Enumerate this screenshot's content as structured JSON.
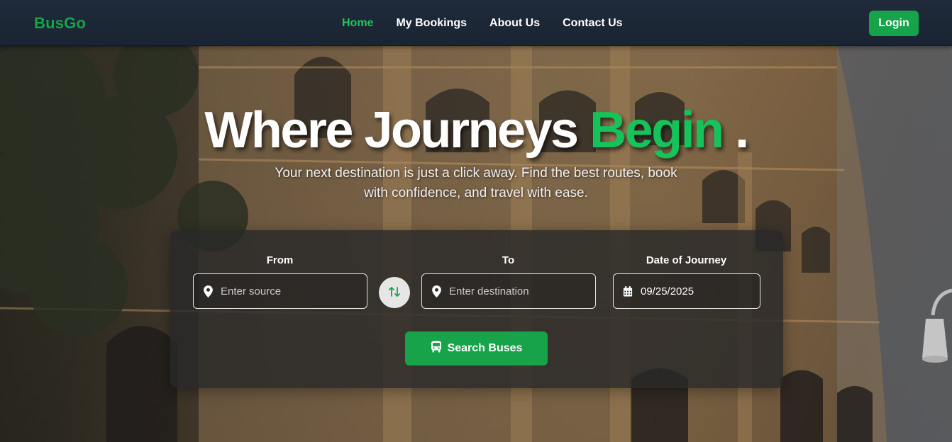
{
  "header": {
    "brand": "BusGo",
    "nav": [
      {
        "label": "Home",
        "active": true
      },
      {
        "label": "My Bookings",
        "active": false
      },
      {
        "label": "About Us",
        "active": false
      },
      {
        "label": "Contact Us",
        "active": false
      }
    ],
    "login_label": "Login"
  },
  "hero": {
    "headline_main": "Where Journeys ",
    "headline_accent": "Begin",
    "headline_end": " .",
    "subtitle": "Your next destination is just a click away. Find the best routes, book with confidence, and travel with ease."
  },
  "search": {
    "from_label": "From",
    "from_placeholder": "Enter source",
    "to_label": "To",
    "to_placeholder": "Enter destination",
    "date_label": "Date of Journey",
    "date_value": "09/25/2025",
    "button_label": "Search Buses",
    "icons": [
      "map-pin-icon",
      "swap-icon",
      "calendar-icon",
      "bus-icon"
    ]
  },
  "colors": {
    "accent": "#16a34a",
    "accent_bright": "#16c35a",
    "header_bg": "#1f2a3a"
  }
}
